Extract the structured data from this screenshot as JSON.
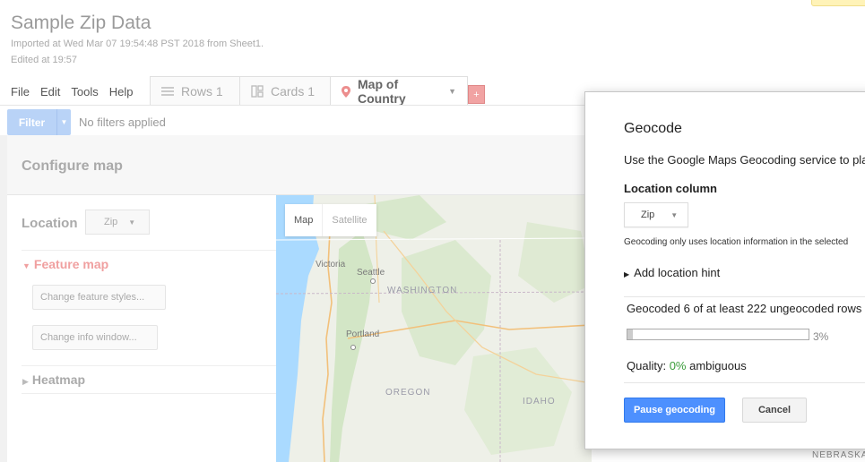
{
  "document": {
    "title": "Sample Zip Data",
    "imported": "Imported at Wed Mar 07 19:54:48 PST 2018 from Sheet1.",
    "edited": "Edited at 19:57"
  },
  "menu": {
    "file": "File",
    "edit": "Edit",
    "tools": "Tools",
    "help": "Help"
  },
  "tabs": {
    "rows": "Rows 1",
    "cards": "Cards 1",
    "map": "Map of Country",
    "add": "+"
  },
  "filter": {
    "button": "Filter",
    "status": "No filters applied"
  },
  "configure": {
    "title": "Configure map",
    "location_label": "Location",
    "location_value": "Zip",
    "feature_map": "Feature map",
    "change_feature_styles": "Change feature styles...",
    "change_info_window": "Change info window...",
    "heatmap": "Heatmap"
  },
  "map": {
    "toggle_map": "Map",
    "toggle_satellite": "Satellite",
    "labels": {
      "victoria": "Victoria",
      "seattle": "Seattle",
      "washington": "WASHINGTON",
      "portland": "Portland",
      "oregon": "OREGON",
      "idaho": "IDAHO",
      "nebraska": "NEBRASKA"
    }
  },
  "geocode": {
    "title": "Geocode",
    "description": "Use the Google Maps Geocoding service to pla",
    "location_column_label": "Location column",
    "location_column_value": "Zip",
    "note": "Geocoding only uses location information in the selected",
    "add_hint": "Add location hint",
    "progress_text": "Geocoded 6 of at least 222 ungeocoded rows",
    "progress_fraction": 0.03,
    "progress_percent": "3%",
    "quality_label": "Quality:",
    "quality_value": "0%",
    "quality_suffix": "ambiguous",
    "pause_button": "Pause geocoding",
    "cancel_button": "Cancel"
  },
  "colors": {
    "accent": "#4d90fe",
    "tab_accent": "#f1a3a3",
    "quality_green": "#3a9d3a"
  }
}
